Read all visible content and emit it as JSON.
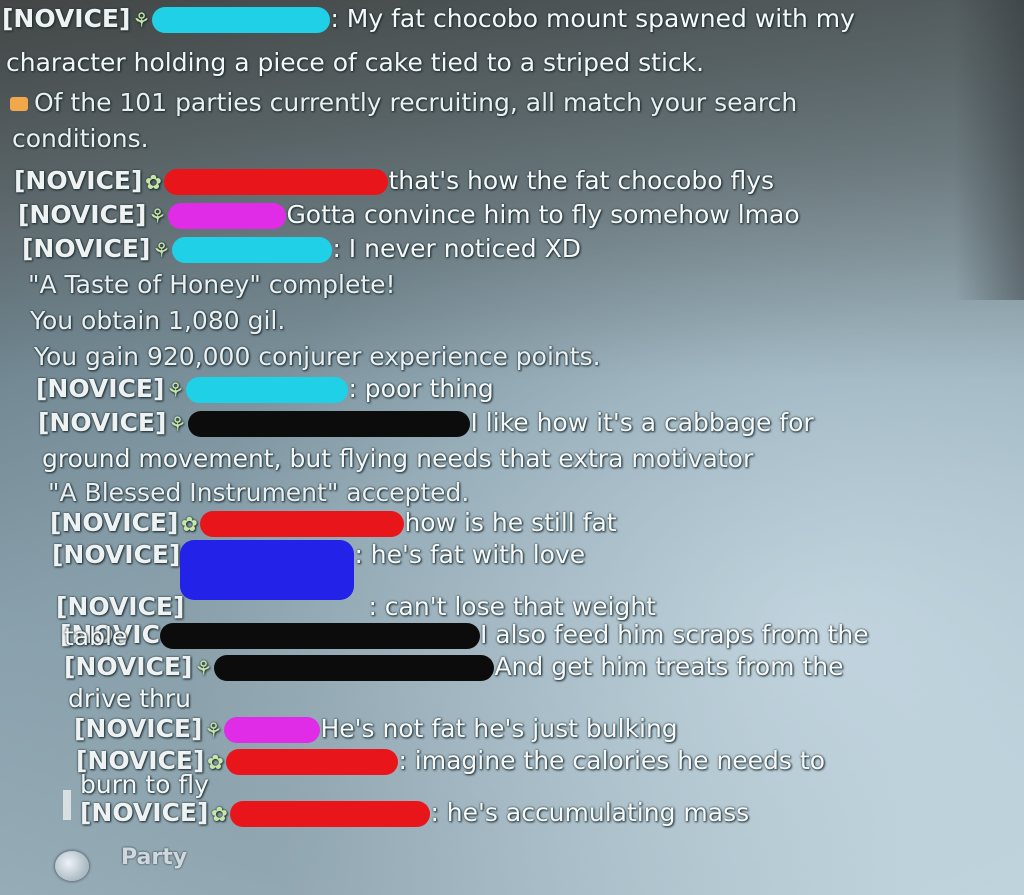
{
  "chat": {
    "l1": {
      "tag": "[NOVICE]",
      "msg": ": My fat chocobo mount spawned with my"
    },
    "l1b": "character holding a piece of cake tied to a striped stick.",
    "l2": "Of the 101 parties currently recruiting, all match your search",
    "l2b": "conditions.",
    "l3": {
      "tag": "[NOVICE]",
      "msg": "that's how the fat chocobo flys"
    },
    "l4": {
      "tag": "[NOVICE]",
      "msg": "Gotta convince him to fly somehow lmao"
    },
    "l5": {
      "tag": "[NOVICE]",
      "msg": ": I never noticed XD"
    },
    "l6": "\"A Taste of Honey\" complete!",
    "l7": "You obtain 1,080 gil.",
    "l8": "You gain 920,000 conjurer experience points.",
    "l9": {
      "tag": "[NOVICE]",
      "msg": ": poor thing"
    },
    "l10": {
      "tag": "[NOVICE]",
      "msg": "I like how it's a cabbage for"
    },
    "l10b": "ground movement, but flying needs that extra motivator",
    "l11": "\"A Blessed Instrument\" accepted.",
    "l12": {
      "tag": "[NOVICE]",
      "msg": "how is he still fat"
    },
    "l13": {
      "tag": "[NOVICE]",
      "msg": ": he's fat with love"
    },
    "l14": {
      "tag": "[NOVICE]",
      "msg": ": can't lose that weight"
    },
    "l15": {
      "tag": "[NOVIC",
      "msg": "I also feed him scraps from the"
    },
    "l15b": "table",
    "l16": {
      "tag": "[NOVICE]",
      "msg": "And get him treats from the"
    },
    "l16b": "drive thru",
    "l17": {
      "tag": "[NOVICE]",
      "msg": "He's not fat he's just bulking"
    },
    "l18": {
      "tag": "[NOVICE]",
      "msg": ": imagine the calories he needs to"
    },
    "l18b": "burn to fly",
    "l19": {
      "tag": "[NOVICE]",
      "msg": ": he's accumulating mass"
    }
  },
  "input": {
    "channel": "Party"
  },
  "icons": {
    "novice": "sprout-icon",
    "mentor": "flower-icon",
    "system": "arrow-icon",
    "chat": "speech-bubble-icon"
  }
}
